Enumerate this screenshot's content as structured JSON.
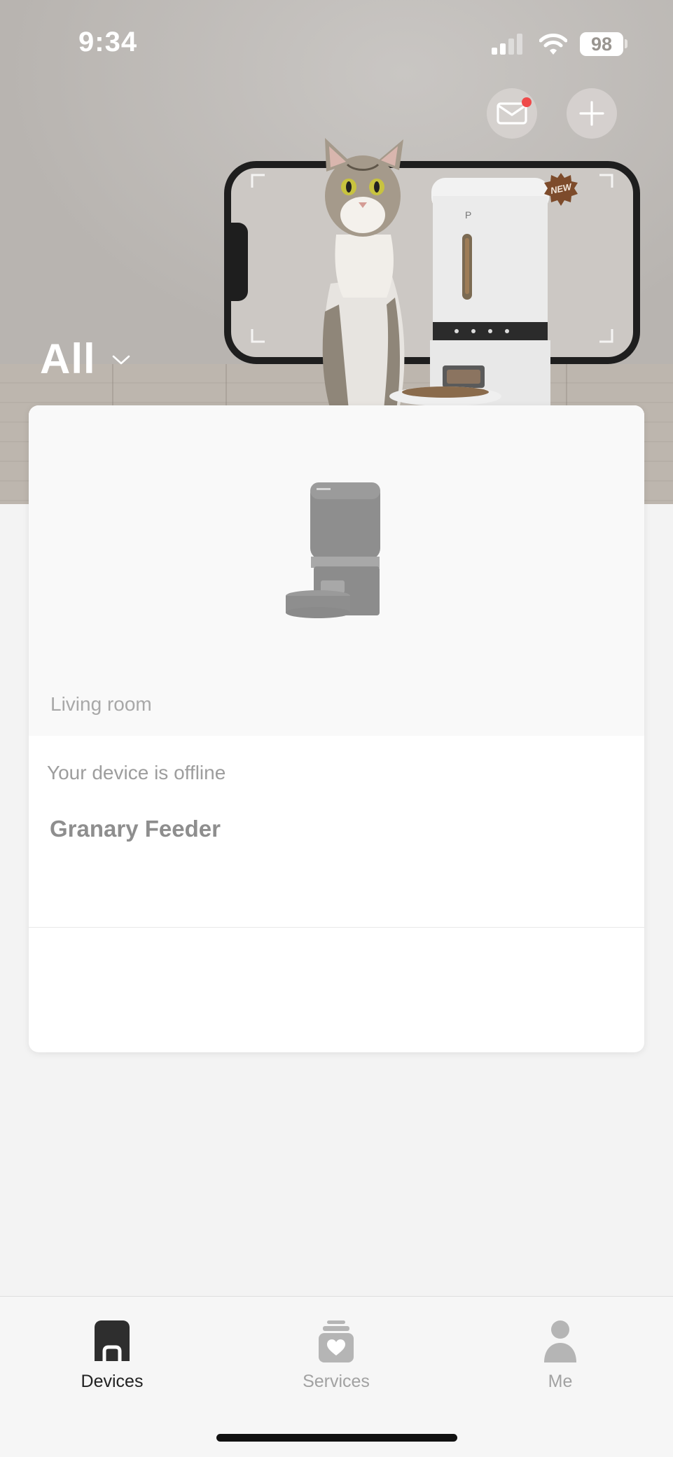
{
  "status_bar": {
    "time": "9:34",
    "battery": "98"
  },
  "header": {
    "mail_icon": "envelope-icon",
    "add_icon": "plus-icon",
    "banner_badge": "NEW",
    "filter_label": "All"
  },
  "device_card": {
    "room": "Living room",
    "status": "Your device is offline",
    "name": "Granary Feeder"
  },
  "bottom_nav": {
    "items": [
      {
        "label": "Devices",
        "icon": "devices-icon",
        "active": true
      },
      {
        "label": "Services",
        "icon": "services-icon",
        "active": false
      },
      {
        "label": "Me",
        "icon": "profile-icon",
        "active": false
      }
    ]
  },
  "colors": {
    "accent_text_active": "#222222",
    "inactive": "#a2a2a2",
    "notification_dot": "#ef4a4a"
  }
}
